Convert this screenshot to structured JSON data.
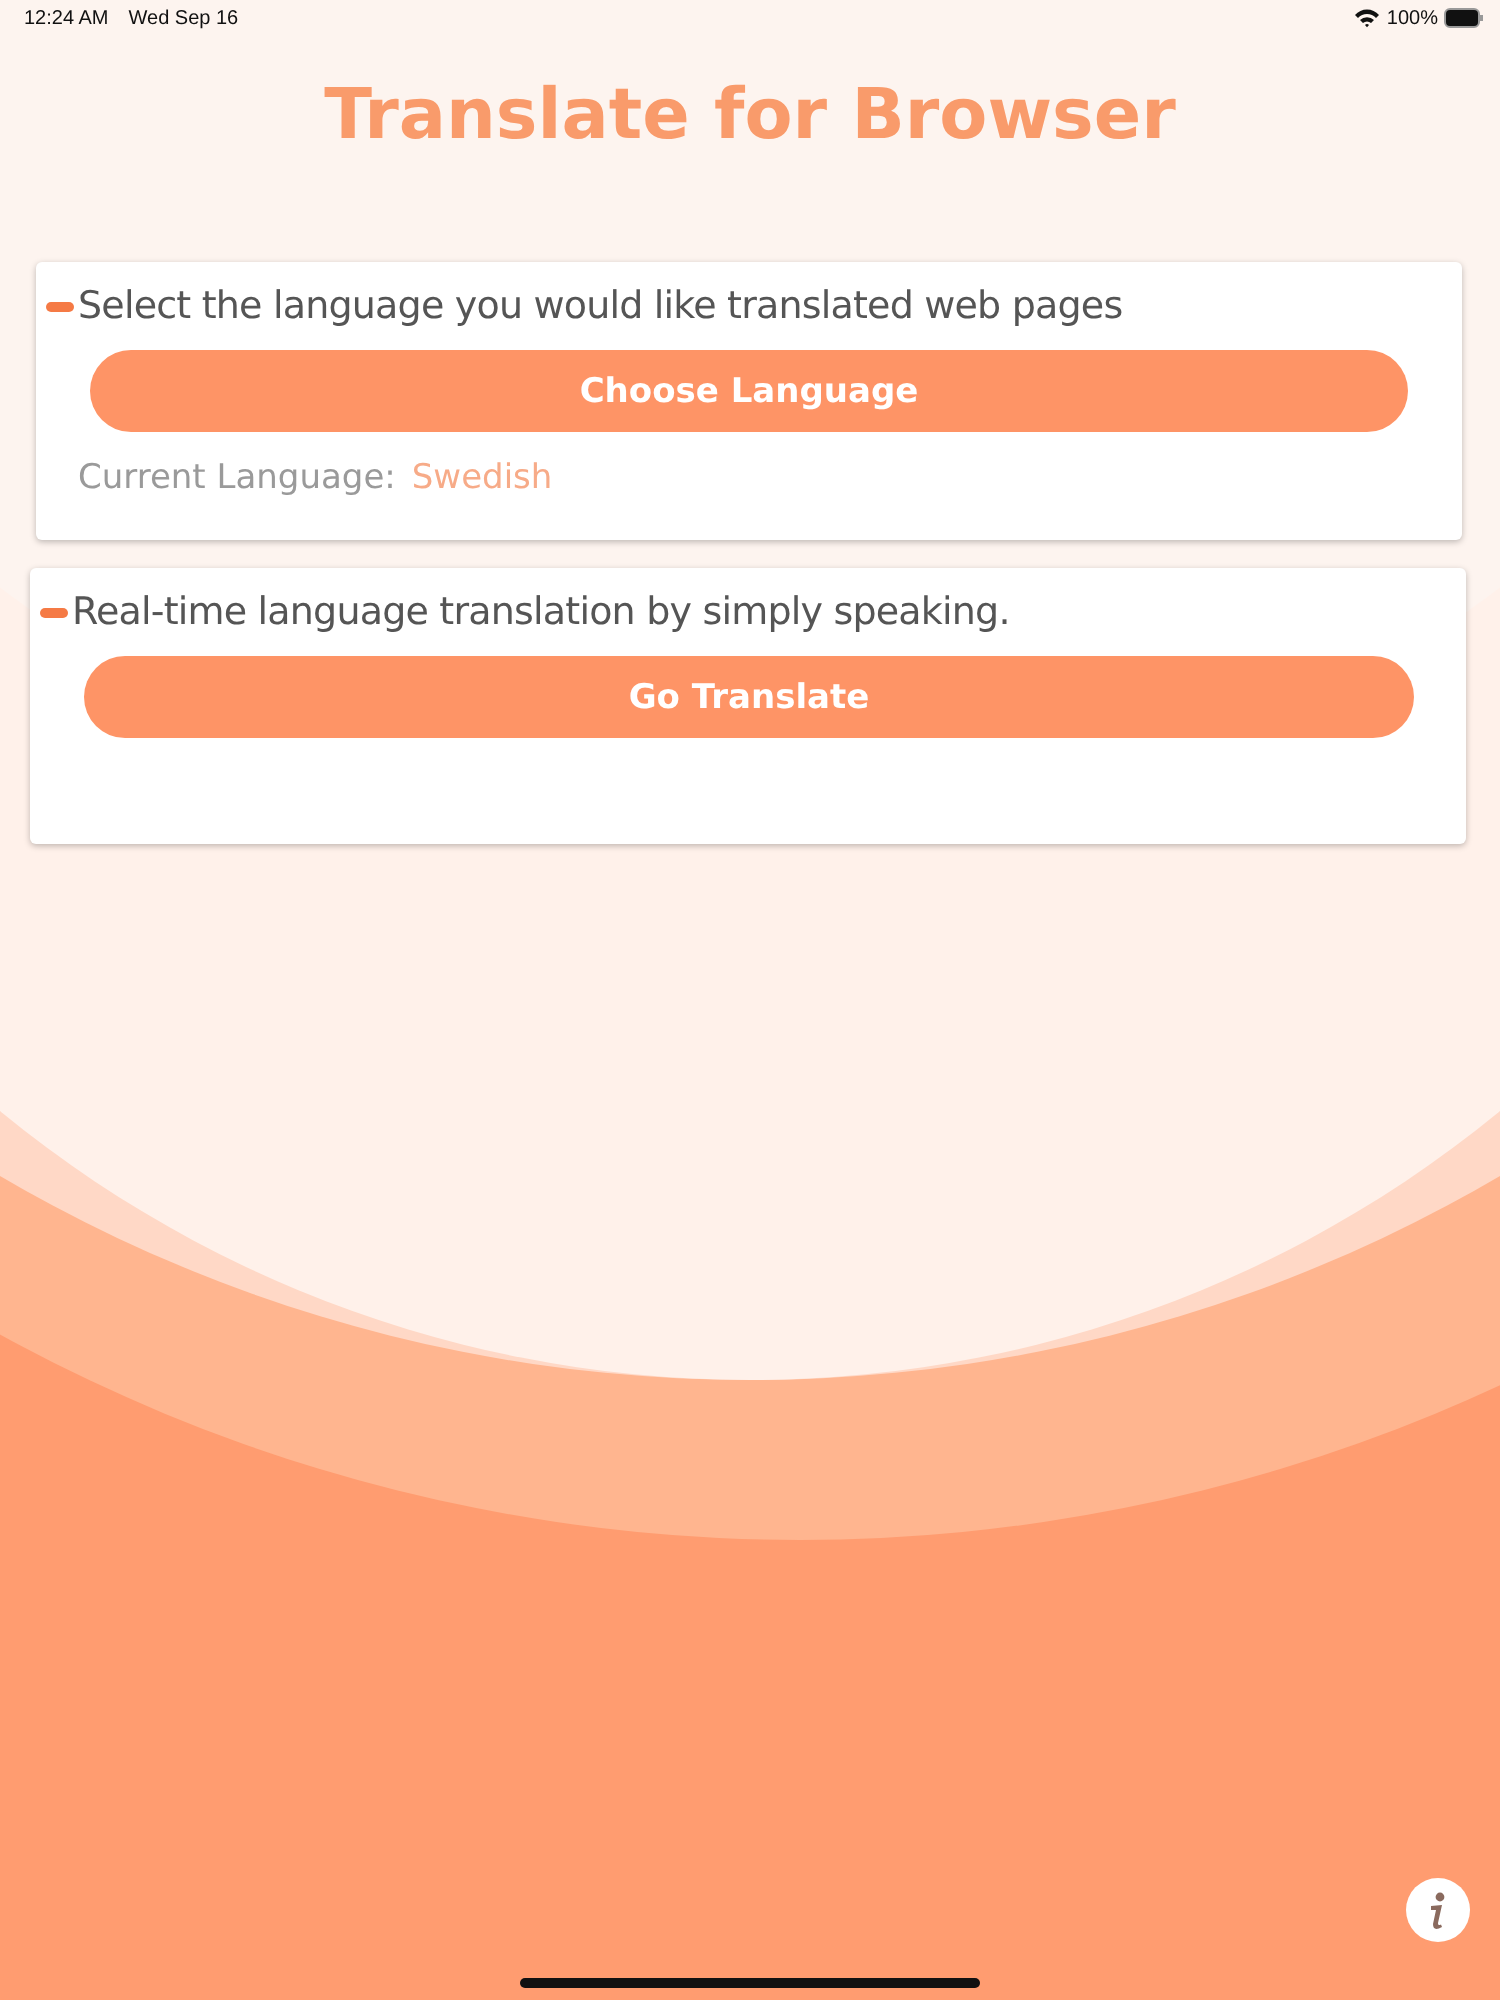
{
  "status_bar": {
    "time": "12:24 AM",
    "date": "Wed Sep 16",
    "battery": "100%"
  },
  "title": "Translate for Browser",
  "cards": [
    {
      "description": "Select the language you would like translated web pages",
      "button": "Choose Language",
      "current_label": "Current Language:",
      "current_value": "Swedish"
    },
    {
      "description": "Real-time language translation by simply speaking.",
      "button": "Go Translate"
    }
  ]
}
